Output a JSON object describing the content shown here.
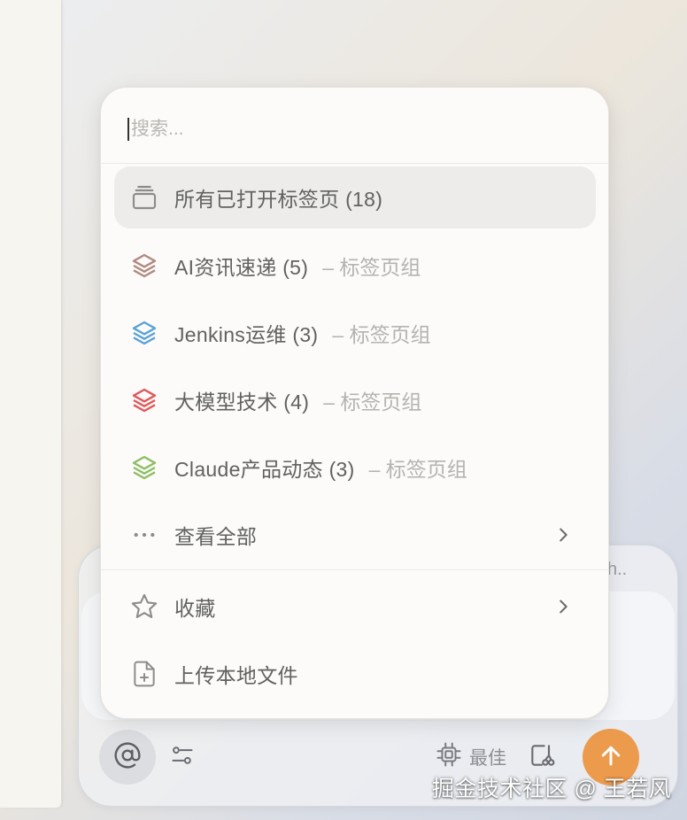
{
  "search": {
    "placeholder": "搜索..."
  },
  "menu": {
    "all_tabs": {
      "label": "所有已打开标签页 (18)",
      "icon": "tabs-stack-icon"
    },
    "groups": [
      {
        "label": "AI资讯速递 (5)",
        "suffix": "– 标签页组",
        "color": "#b08a80",
        "icon": "layers-icon"
      },
      {
        "label": "Jenkins运维 (3)",
        "suffix": "– 标签页组",
        "color": "#5ba3d6",
        "icon": "layers-icon"
      },
      {
        "label": "大模型技术 (4)",
        "suffix": "– 标签页组",
        "color": "#e0575a",
        "icon": "layers-icon"
      },
      {
        "label": "Claude产品动态 (3)",
        "suffix": "– 标签页组",
        "color": "#8dbf66",
        "icon": "layers-icon"
      }
    ],
    "view_all": {
      "label": "查看全部",
      "icon": "more-horizontal-icon"
    },
    "favorites": {
      "label": "收藏",
      "icon": "star-icon"
    },
    "upload": {
      "label": "上传本地文件",
      "icon": "file-plus-icon"
    }
  },
  "composer": {
    "hint_text": "h..",
    "model_label": "最佳",
    "accent_color": "#ec9a4c"
  },
  "watermark": "掘金技术社区 @ 王若风"
}
